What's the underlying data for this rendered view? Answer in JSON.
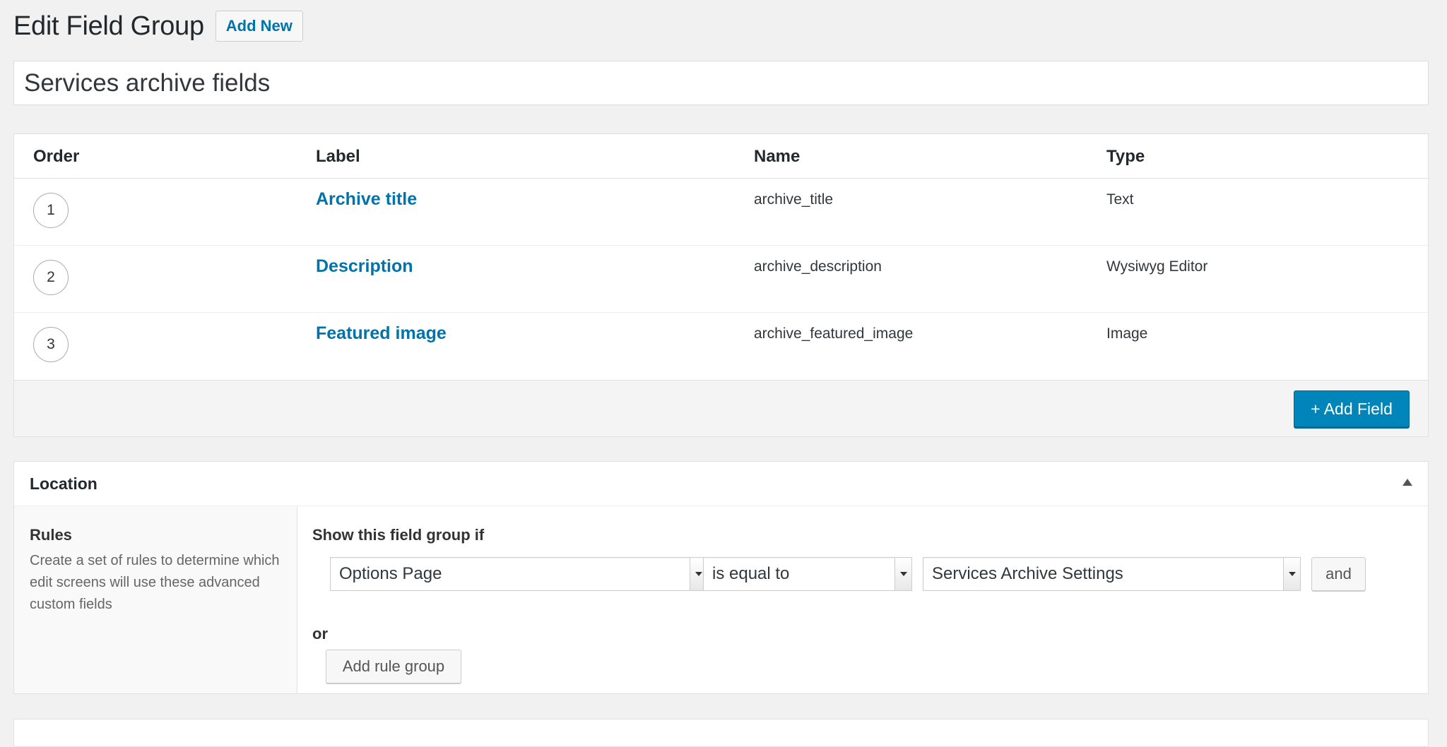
{
  "header": {
    "title": "Edit Field Group",
    "add_new_label": "Add New"
  },
  "field_group": {
    "title": "Services archive fields"
  },
  "fields_table": {
    "columns": [
      "Order",
      "Label",
      "Name",
      "Type"
    ],
    "rows": [
      {
        "order": "1",
        "label": "Archive title",
        "name": "archive_title",
        "type": "Text"
      },
      {
        "order": "2",
        "label": "Description",
        "name": "archive_description",
        "type": "Wysiwyg Editor"
      },
      {
        "order": "3",
        "label": "Featured image",
        "name": "archive_featured_image",
        "type": "Image"
      }
    ],
    "add_field_label": "+ Add Field"
  },
  "location": {
    "title": "Location",
    "rules_title": "Rules",
    "rules_description": "Create a set of rules to determine which edit screens will use these advanced custom fields",
    "show_if_label": "Show this field group if",
    "rule": {
      "param": "Options Page",
      "operator": "is equal to",
      "value": "Services Archive Settings"
    },
    "and_label": "and",
    "or_label": "or",
    "add_rule_group_label": "Add rule group"
  },
  "colors": {
    "link": "#0073aa",
    "primary_button": "#0085ba",
    "background": "#f1f1f1"
  }
}
